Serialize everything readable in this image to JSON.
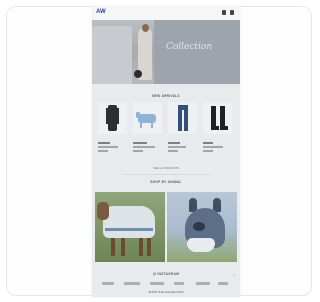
{
  "header": {
    "logo_text": "AW",
    "icons": [
      "search-icon",
      "cart-icon"
    ]
  },
  "hero": {
    "script_text": "Collection",
    "colors": {
      "wall": "#9ea4ab",
      "accent": "#2b2d31"
    }
  },
  "products_section": {
    "title": "NEW ARRIVALS",
    "see_all": "SEE ALL PRODUCTS",
    "items": [
      {
        "name": "long-coat",
        "icon": "coat-icon"
      },
      {
        "name": "horse-rug",
        "icon": "horse-rug-icon"
      },
      {
        "name": "jeans",
        "icon": "jeans-icon"
      },
      {
        "name": "riding-boots",
        "icon": "boots-icon"
      }
    ]
  },
  "feature_section": {
    "title": "SHOP BY ANIMAL",
    "images": [
      "horse-rug-photo",
      "fly-mask-photo"
    ]
  },
  "footer": {
    "instagram_title": "@ INSTAGRAM",
    "bottom_link": "SHOP THE COLLECTION"
  },
  "colors": {
    "card_border": "#e5e7ea",
    "screen_bg": "#e8ebee",
    "text_muted": "#555a60"
  }
}
